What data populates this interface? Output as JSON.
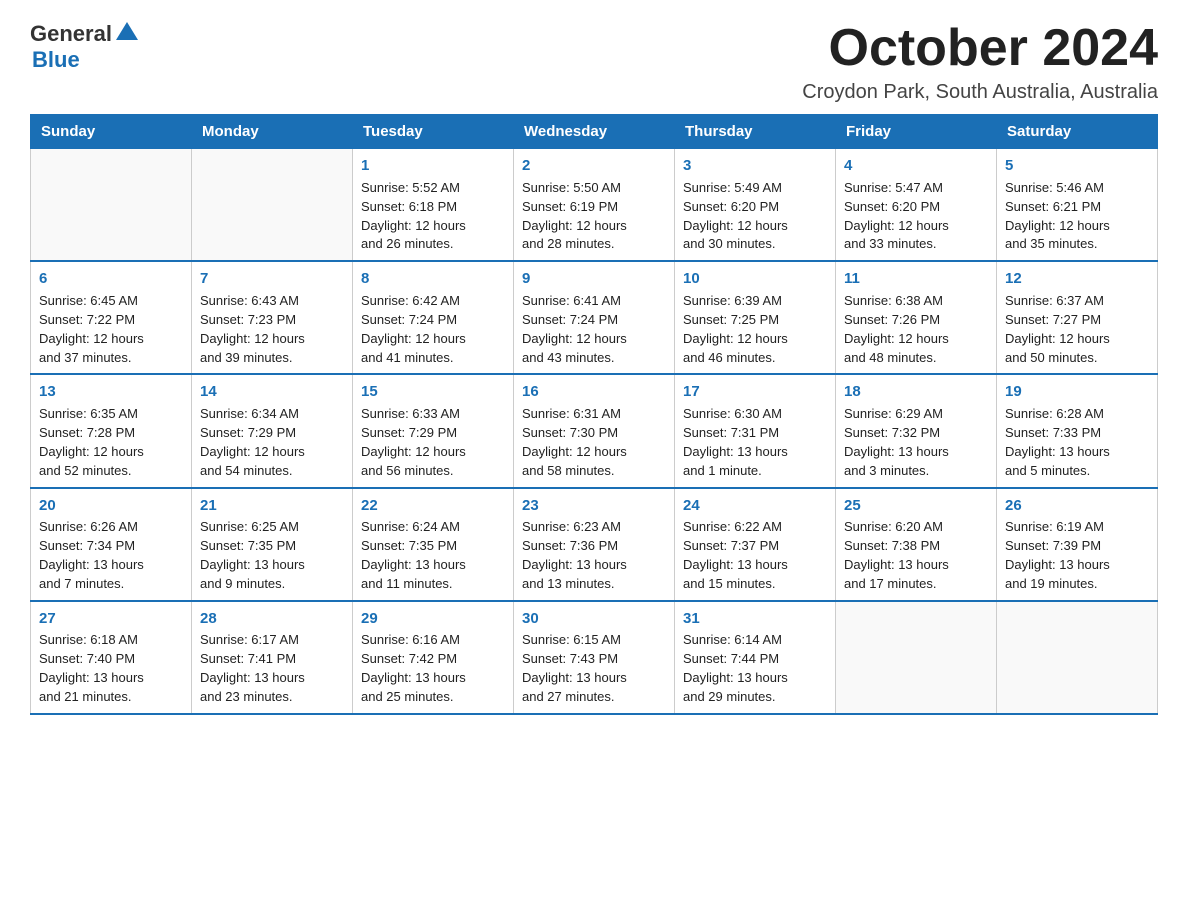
{
  "header": {
    "logo_general": "General",
    "logo_blue": "Blue",
    "month": "October 2024",
    "location": "Croydon Park, South Australia, Australia"
  },
  "days_of_week": [
    "Sunday",
    "Monday",
    "Tuesday",
    "Wednesday",
    "Thursday",
    "Friday",
    "Saturday"
  ],
  "weeks": [
    [
      {
        "day": "",
        "info": ""
      },
      {
        "day": "",
        "info": ""
      },
      {
        "day": "1",
        "info": "Sunrise: 5:52 AM\nSunset: 6:18 PM\nDaylight: 12 hours\nand 26 minutes."
      },
      {
        "day": "2",
        "info": "Sunrise: 5:50 AM\nSunset: 6:19 PM\nDaylight: 12 hours\nand 28 minutes."
      },
      {
        "day": "3",
        "info": "Sunrise: 5:49 AM\nSunset: 6:20 PM\nDaylight: 12 hours\nand 30 minutes."
      },
      {
        "day": "4",
        "info": "Sunrise: 5:47 AM\nSunset: 6:20 PM\nDaylight: 12 hours\nand 33 minutes."
      },
      {
        "day": "5",
        "info": "Sunrise: 5:46 AM\nSunset: 6:21 PM\nDaylight: 12 hours\nand 35 minutes."
      }
    ],
    [
      {
        "day": "6",
        "info": "Sunrise: 6:45 AM\nSunset: 7:22 PM\nDaylight: 12 hours\nand 37 minutes."
      },
      {
        "day": "7",
        "info": "Sunrise: 6:43 AM\nSunset: 7:23 PM\nDaylight: 12 hours\nand 39 minutes."
      },
      {
        "day": "8",
        "info": "Sunrise: 6:42 AM\nSunset: 7:24 PM\nDaylight: 12 hours\nand 41 minutes."
      },
      {
        "day": "9",
        "info": "Sunrise: 6:41 AM\nSunset: 7:24 PM\nDaylight: 12 hours\nand 43 minutes."
      },
      {
        "day": "10",
        "info": "Sunrise: 6:39 AM\nSunset: 7:25 PM\nDaylight: 12 hours\nand 46 minutes."
      },
      {
        "day": "11",
        "info": "Sunrise: 6:38 AM\nSunset: 7:26 PM\nDaylight: 12 hours\nand 48 minutes."
      },
      {
        "day": "12",
        "info": "Sunrise: 6:37 AM\nSunset: 7:27 PM\nDaylight: 12 hours\nand 50 minutes."
      }
    ],
    [
      {
        "day": "13",
        "info": "Sunrise: 6:35 AM\nSunset: 7:28 PM\nDaylight: 12 hours\nand 52 minutes."
      },
      {
        "day": "14",
        "info": "Sunrise: 6:34 AM\nSunset: 7:29 PM\nDaylight: 12 hours\nand 54 minutes."
      },
      {
        "day": "15",
        "info": "Sunrise: 6:33 AM\nSunset: 7:29 PM\nDaylight: 12 hours\nand 56 minutes."
      },
      {
        "day": "16",
        "info": "Sunrise: 6:31 AM\nSunset: 7:30 PM\nDaylight: 12 hours\nand 58 minutes."
      },
      {
        "day": "17",
        "info": "Sunrise: 6:30 AM\nSunset: 7:31 PM\nDaylight: 13 hours\nand 1 minute."
      },
      {
        "day": "18",
        "info": "Sunrise: 6:29 AM\nSunset: 7:32 PM\nDaylight: 13 hours\nand 3 minutes."
      },
      {
        "day": "19",
        "info": "Sunrise: 6:28 AM\nSunset: 7:33 PM\nDaylight: 13 hours\nand 5 minutes."
      }
    ],
    [
      {
        "day": "20",
        "info": "Sunrise: 6:26 AM\nSunset: 7:34 PM\nDaylight: 13 hours\nand 7 minutes."
      },
      {
        "day": "21",
        "info": "Sunrise: 6:25 AM\nSunset: 7:35 PM\nDaylight: 13 hours\nand 9 minutes."
      },
      {
        "day": "22",
        "info": "Sunrise: 6:24 AM\nSunset: 7:35 PM\nDaylight: 13 hours\nand 11 minutes."
      },
      {
        "day": "23",
        "info": "Sunrise: 6:23 AM\nSunset: 7:36 PM\nDaylight: 13 hours\nand 13 minutes."
      },
      {
        "day": "24",
        "info": "Sunrise: 6:22 AM\nSunset: 7:37 PM\nDaylight: 13 hours\nand 15 minutes."
      },
      {
        "day": "25",
        "info": "Sunrise: 6:20 AM\nSunset: 7:38 PM\nDaylight: 13 hours\nand 17 minutes."
      },
      {
        "day": "26",
        "info": "Sunrise: 6:19 AM\nSunset: 7:39 PM\nDaylight: 13 hours\nand 19 minutes."
      }
    ],
    [
      {
        "day": "27",
        "info": "Sunrise: 6:18 AM\nSunset: 7:40 PM\nDaylight: 13 hours\nand 21 minutes."
      },
      {
        "day": "28",
        "info": "Sunrise: 6:17 AM\nSunset: 7:41 PM\nDaylight: 13 hours\nand 23 minutes."
      },
      {
        "day": "29",
        "info": "Sunrise: 6:16 AM\nSunset: 7:42 PM\nDaylight: 13 hours\nand 25 minutes."
      },
      {
        "day": "30",
        "info": "Sunrise: 6:15 AM\nSunset: 7:43 PM\nDaylight: 13 hours\nand 27 minutes."
      },
      {
        "day": "31",
        "info": "Sunrise: 6:14 AM\nSunset: 7:44 PM\nDaylight: 13 hours\nand 29 minutes."
      },
      {
        "day": "",
        "info": ""
      },
      {
        "day": "",
        "info": ""
      }
    ]
  ]
}
